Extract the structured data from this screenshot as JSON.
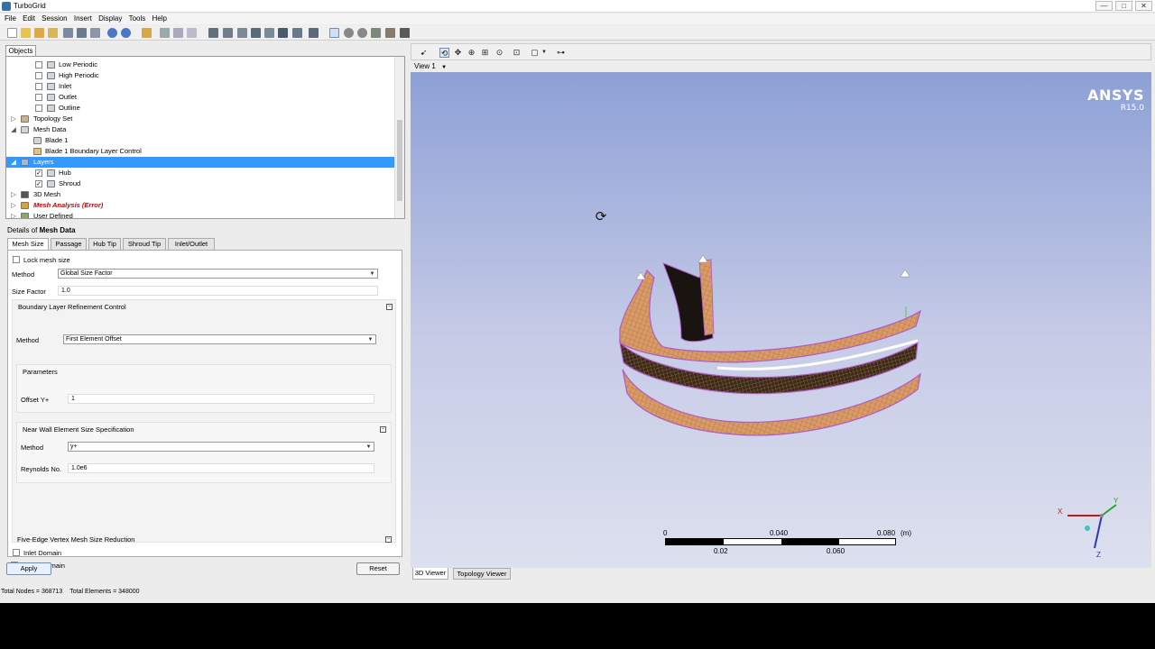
{
  "window": {
    "title": "TurboGrid",
    "minimize": "—",
    "maximize": "□",
    "close": "✕"
  },
  "menu": [
    "File",
    "Edit",
    "Session",
    "Insert",
    "Display",
    "Tools",
    "Help"
  ],
  "objects_tab": "Objects",
  "tree": [
    {
      "label": "Low Periodic",
      "icon": "periodic-surface-icon",
      "checkbox": true,
      "checked": false
    },
    {
      "label": "High Periodic",
      "icon": "periodic-surface-icon",
      "checkbox": true,
      "checked": false
    },
    {
      "label": "Inlet",
      "icon": "inlet-icon",
      "checkbox": true,
      "checked": false
    },
    {
      "label": "Outlet",
      "icon": "outlet-icon",
      "checkbox": true,
      "checked": false
    },
    {
      "label": "Outline",
      "icon": "outline-icon",
      "checkbox": true,
      "checked": false
    },
    {
      "label": "Topology Set",
      "icon": "topology-set-icon",
      "expander": "▷"
    },
    {
      "label": "Mesh Data",
      "icon": "mesh-data-icon",
      "expander": "◢"
    },
    {
      "label": "Blade 1",
      "icon": "blade-icon"
    },
    {
      "label": "Blade 1 Boundary Layer Control",
      "icon": "boundary-layer-icon"
    },
    {
      "label": "Layers",
      "icon": "layers-icon",
      "expander": "◢",
      "selected": true
    },
    {
      "label": "Hub",
      "icon": "surface-icon",
      "checkbox": true,
      "checked": true
    },
    {
      "label": "Shroud",
      "icon": "surface-icon",
      "checkbox": true,
      "checked": true
    },
    {
      "label": "3D Mesh",
      "icon": "mesh-3d-icon",
      "expander": "▷"
    },
    {
      "label": "Mesh Analysis (Error)",
      "icon": "mesh-analysis-icon",
      "expander": "▷",
      "error": true
    },
    {
      "label": "User Defined",
      "icon": "user-defined-icon",
      "expander": "▷"
    }
  ],
  "details": {
    "title_prefix": "Details of ",
    "title_object": "Mesh Data",
    "tabs": [
      "Mesh Size",
      "Passage",
      "Hub Tip",
      "Shroud Tip",
      "Inlet/Outlet"
    ],
    "lock_mesh_size": "Lock mesh size",
    "method_label": "Method",
    "method_value": "Global Size Factor",
    "size_factor_label": "Size Factor",
    "size_factor_value": "1.0",
    "blrc_title": "Boundary Layer Refinement Control",
    "blrc_method_label": "Method",
    "blrc_method_value": "First Element Offset",
    "parameters_title": "Parameters",
    "offset_label": "Offset Y+",
    "offset_value": "1",
    "near_wall_title": "Near Wall Element Size Specification",
    "nw_method_label": "Method",
    "nw_method_value": "y+",
    "reynolds_label": "Reynolds No.",
    "reynolds_value": "1.0e6",
    "five_edge_title": "Five-Edge Vertex Mesh Size Reduction",
    "inlet_domain": "Inlet Domain",
    "outlet_domain": "Outlet Domain",
    "apply": "Apply",
    "reset": "Reset"
  },
  "viewer": {
    "view_label": "View 1",
    "brand": "ANSYS",
    "version": "R15.0",
    "scale": {
      "t0": "0",
      "t1": "0.040",
      "t2": "0.080",
      "unit": "(m)",
      "b1": "0.02",
      "b2": "0.060"
    },
    "axes": {
      "x": "X",
      "y": "Y",
      "z": "Z"
    },
    "tabs": [
      "3D Viewer",
      "Topology Viewer"
    ]
  },
  "status": {
    "nodes": "Total Nodes = 368713",
    "elements": "Total Elements = 348000"
  },
  "colors": {
    "selection": "#3399ff",
    "error": "#cc0000",
    "mesh_copper": "#d89a66",
    "mesh_edge": "#b05ac8"
  }
}
